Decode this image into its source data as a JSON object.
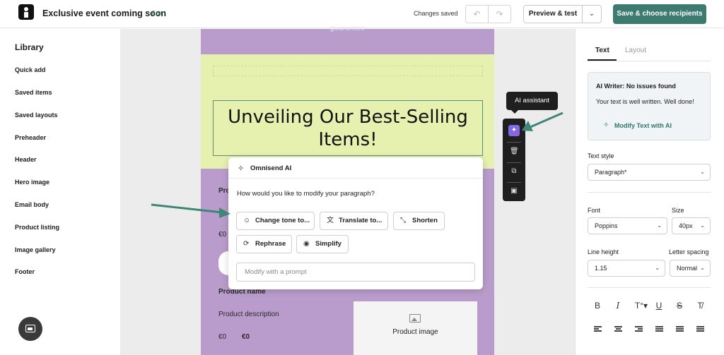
{
  "topbar": {
    "title": "Exclusive event coming soon",
    "edit_label": "Edit",
    "status": "Changes saved",
    "undo_icon": "↶",
    "redo_icon": "↷",
    "preview_label": "Preview & test",
    "preview_dropdown_icon": "⌄",
    "save_label": "Save & choose recipients",
    "accent": "#3d7b70"
  },
  "library": {
    "heading": "Library",
    "items": [
      "Quick add",
      "Saved items",
      "Saved layouts",
      "Preheader",
      "Header",
      "Hero image",
      "Email body",
      "Product listing",
      "Image gallery",
      "Footer"
    ]
  },
  "email": {
    "top_text": "guarantee",
    "headline": "Unveiling Our Best-Selling Items!",
    "body_labels": {
      "product_name_partial": "Pro",
      "price_partial": "€0",
      "product_name": "Product name",
      "product_description": "Product description",
      "price": "€0",
      "old_price": "€0",
      "product_image": "Product image"
    }
  },
  "ai_popup": {
    "title": "Omnisend AI",
    "question": "How would you like to modify your paragraph?",
    "buttons": {
      "change_tone": "Change tone to...",
      "translate": "Translate to...",
      "shorten": "Shorten",
      "rephrase": "Rephrase",
      "simplify": "Simplify"
    },
    "prompt_placeholder": "Modify with a prompt"
  },
  "floating_toolbar": {
    "tooltip": "AI assistant",
    "ai_icon_glyph": "✦"
  },
  "right_panel": {
    "tabs": [
      "Text",
      "Layout"
    ],
    "ai_card": {
      "title": "AI Writer: No issues found",
      "message": "Your text is well written. Well done!",
      "link": "Modify Text with AI"
    },
    "text_style_label": "Text style",
    "text_style_value": "Paragraph*",
    "font_label": "Font",
    "font_value": "Poppins",
    "size_label": "Size",
    "size_value": "40px",
    "line_height_label": "Line height",
    "line_height_value": "1.15",
    "letter_spacing_label": "Letter spacing",
    "letter_spacing_value": "Normal",
    "format_icons": [
      "B",
      "I",
      "T°▾",
      "U",
      "S",
      "T̸"
    ]
  }
}
